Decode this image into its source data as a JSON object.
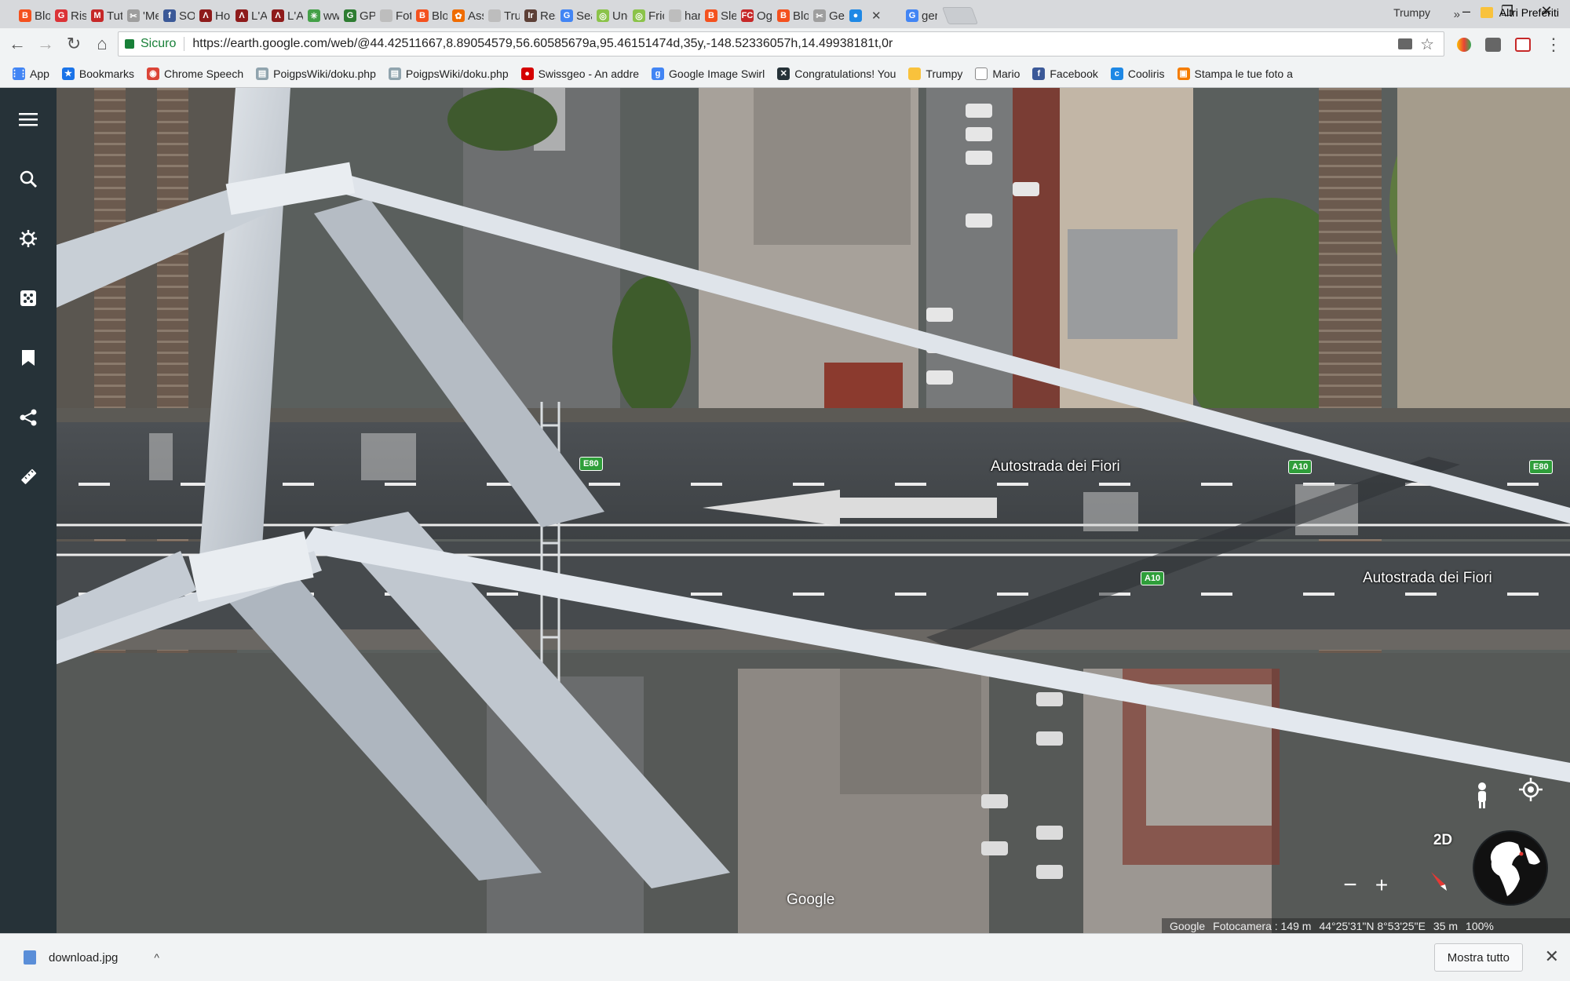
{
  "browser": {
    "tabs": [
      {
        "label": "Blo",
        "color": "#f4511e",
        "glyph": "B"
      },
      {
        "label": "Ris",
        "color": "#db3236",
        "glyph": "G"
      },
      {
        "label": "Tut",
        "color": "#c62828",
        "glyph": "M"
      },
      {
        "label": "'Me",
        "color": "#9e9e9e",
        "glyph": "✂"
      },
      {
        "label": "SO",
        "color": "#3b5998",
        "glyph": "f"
      },
      {
        "label": "Ho",
        "color": "#8e1b1b",
        "glyph": "Λ"
      },
      {
        "label": "L'A",
        "color": "#8e1b1b",
        "glyph": "Λ"
      },
      {
        "label": "L'A",
        "color": "#8e1b1b",
        "glyph": "Λ"
      },
      {
        "label": "ww",
        "color": "#43a047",
        "glyph": "✳"
      },
      {
        "label": "GP:",
        "color": "#2e7d32",
        "glyph": "G"
      },
      {
        "label": "Fot",
        "color": "#bdbdbd",
        "glyph": ""
      },
      {
        "label": "Blo",
        "color": "#f4511e",
        "glyph": "B"
      },
      {
        "label": "Ass",
        "color": "#ef6c00",
        "glyph": "✿"
      },
      {
        "label": "Tru",
        "color": "#bdbdbd",
        "glyph": ""
      },
      {
        "label": "Res",
        "color": "#5d4037",
        "glyph": "Ir"
      },
      {
        "label": "Sea",
        "color": "#4285f4",
        "glyph": "G"
      },
      {
        "label": "Unc",
        "color": "#8bc34a",
        "glyph": "◎"
      },
      {
        "label": "Fric",
        "color": "#8bc34a",
        "glyph": "◎"
      },
      {
        "label": "har",
        "color": "#bdbdbd",
        "glyph": ""
      },
      {
        "label": "Sle",
        "color": "#f4511e",
        "glyph": "B"
      },
      {
        "label": "Og",
        "color": "#c62828",
        "glyph": "FC"
      },
      {
        "label": "Blo",
        "color": "#f4511e",
        "glyph": "B"
      },
      {
        "label": "Ge",
        "color": "#9e9e9e",
        "glyph": "✂"
      },
      {
        "label": "",
        "color": "#1e88e5",
        "glyph": "●",
        "active": true
      },
      {
        "label": "ger",
        "color": "#4285f4",
        "glyph": "G"
      }
    ],
    "profile_name": "Trumpy",
    "window_controls": {
      "minimize": "–",
      "maximize": "❐",
      "close": "✕"
    },
    "nav": {
      "back": "←",
      "forward": "→",
      "reload": "↻",
      "home": "⌂"
    },
    "omnibox": {
      "secure_label": "Sicuro",
      "url": "https://earth.google.com/web/@44.42511667,8.89054579,56.60585679a,95.46151474d,35y,-148.52336057h,14.49938181t,0r",
      "star": "☆"
    },
    "bookmarks": [
      {
        "label": "App",
        "icon": "apps-icon",
        "color": "#4285f4",
        "glyph": "⋮⋮"
      },
      {
        "label": "Bookmarks",
        "icon": "star-icon",
        "color": "#1a73e8",
        "glyph": "★"
      },
      {
        "label": "Chrome Speech",
        "icon": "chrome-icon",
        "color": "#db4437",
        "glyph": "◉"
      },
      {
        "label": "PoigpsWiki/doku.php",
        "icon": "page-icon",
        "color": "#90a4ae",
        "glyph": "▤"
      },
      {
        "label": "PoigpsWiki/doku.php",
        "icon": "page-icon",
        "color": "#90a4ae",
        "glyph": "▤"
      },
      {
        "label": "Swissgeo - An addre",
        "icon": "swissgeo-icon",
        "color": "#d50000",
        "glyph": "●"
      },
      {
        "label": "Google Image Swirl",
        "icon": "google-icon",
        "color": "#4285f4",
        "glyph": "g"
      },
      {
        "label": "Congratulations! You",
        "icon": "x-icon",
        "color": "#263238",
        "glyph": "✕"
      },
      {
        "label": "Trumpy",
        "icon": "folder-icon",
        "color": "#f9c23c",
        "glyph": ""
      },
      {
        "label": "Mario",
        "icon": "page-icon",
        "color": "#ffffff",
        "glyph": ""
      },
      {
        "label": "Facebook",
        "icon": "facebook-icon",
        "color": "#3b5998",
        "glyph": "f"
      },
      {
        "label": "Cooliris",
        "icon": "cooliris-icon",
        "color": "#1e88e5",
        "glyph": "c"
      },
      {
        "label": "Stampa le tue foto a",
        "icon": "photo-icon",
        "color": "#f57c00",
        "glyph": "▣"
      }
    ],
    "bookmarks_more": "»",
    "other_bookmarks": "Altri Preferiti"
  },
  "earth": {
    "sidebar_icons": [
      "menu-icon",
      "search-icon",
      "voyager-icon",
      "feeling-lucky-icon",
      "projects-icon",
      "share-icon",
      "measure-icon"
    ],
    "road_labels": [
      {
        "text": "Autostrada dei Fiori"
      },
      {
        "text": "Autostrada dei Fiori"
      }
    ],
    "shields": [
      "E80",
      "A10",
      "E80",
      "A10"
    ],
    "watermark": "Google",
    "status": {
      "provider": "Google",
      "camera": "Fotocamera : 149 m",
      "coords": "44°25'31\"N 8°53'25\"E",
      "scale": "35 m",
      "loading": "100%"
    },
    "controls": {
      "two_d": "2D",
      "zoom_out": "−",
      "zoom_in": "+"
    }
  },
  "download_shelf": {
    "filename": "download.jpg",
    "chevron": "^",
    "show_all": "Mostra tutto",
    "close": "✕"
  },
  "colors": {
    "earth_sidebar": "#263238",
    "secure_green": "#188038",
    "highway_shield": "#2f9e3a"
  }
}
